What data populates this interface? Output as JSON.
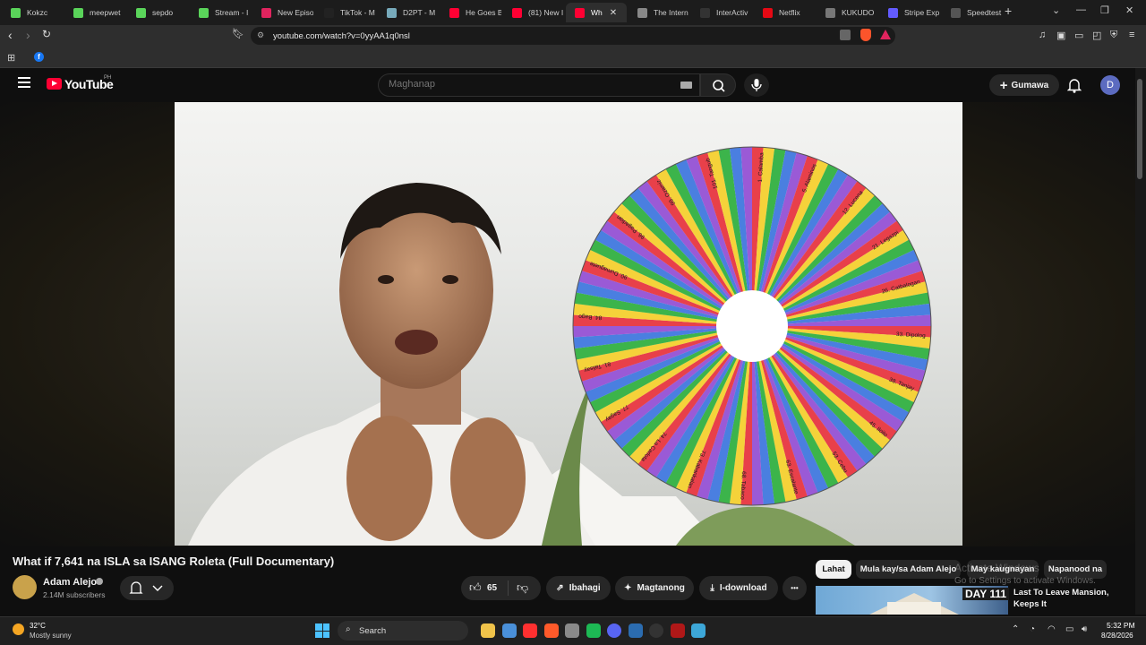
{
  "browser": {
    "tabs": [
      {
        "label": "Kokzc",
        "color": "#5ad45a"
      },
      {
        "label": "meepwet",
        "color": "#5ad45a"
      },
      {
        "label": "sepdo",
        "color": "#5ad45a"
      },
      {
        "label": "Stream - I",
        "color": "#5ad45a"
      },
      {
        "label": "New Episo",
        "color": "#e0245e"
      },
      {
        "label": "TikTok - M",
        "color": "#222222"
      },
      {
        "label": "D2PT - M",
        "color": "#7ab"
      },
      {
        "label": "He Goes B",
        "color": "#ff0033"
      },
      {
        "label": "(81) New I",
        "color": "#ff0033"
      },
      {
        "label": "Wh",
        "color": "#ff0033"
      },
      {
        "label": "The Intern",
        "color": "#888888"
      },
      {
        "label": "InterActiv",
        "color": "#333333"
      },
      {
        "label": "Netflix",
        "color": "#e50914"
      },
      {
        "label": "KUKUDO",
        "color": "#777777"
      },
      {
        "label": "Stripe Exp",
        "color": "#635bff"
      },
      {
        "label": "Speedtest",
        "color": "#555555"
      }
    ],
    "active_tab_index": 9,
    "new_tab": "+",
    "url": "youtube.com/watch?v=0yyAA1q0nsl"
  },
  "youtube": {
    "logo_text": "YouTube",
    "country": "PH",
    "search_placeholder": "Maghanap",
    "create_label": "Gumawa",
    "avatar_letter": "D",
    "avatar_color": "#5c6bc0"
  },
  "video": {
    "title": "What if 7,641 na ISLA sa ISANG Roleta (Full Documentary)",
    "channel": "Adam Alejo",
    "subscribers": "2.14M subscribers",
    "likes": "65",
    "share_label": "Ibahagi",
    "ask_label": "Magtanong",
    "download_label": "I-download",
    "more": "•••",
    "wheel_colors": [
      "#e8404a",
      "#f5d23a",
      "#3cb44b",
      "#4a7fe0",
      "#9a5ad6"
    ],
    "wheel_labels": [
      {
        "n": "1",
        "t": "Calamba"
      },
      {
        "n": "5",
        "t": "Alaminos"
      },
      {
        "n": "12",
        "t": "Lucena"
      },
      {
        "n": "21",
        "t": "Legazpi"
      },
      {
        "n": "26",
        "t": "Catbalogan"
      },
      {
        "n": "33",
        "t": "Dipolog"
      },
      {
        "n": "38",
        "t": "Tanjay"
      },
      {
        "n": "45",
        "t": "Iloilo"
      },
      {
        "n": "53",
        "t": "Cebu"
      },
      {
        "n": "63",
        "t": "Escalante"
      },
      {
        "n": "68",
        "t": "Tabaco"
      },
      {
        "n": "73",
        "t": "Kabankalan"
      },
      {
        "n": "74",
        "t": "La Carlota"
      },
      {
        "n": "77",
        "t": "Sagay"
      },
      {
        "n": "81",
        "t": "Talisay"
      },
      {
        "n": "84",
        "t": "Bago"
      },
      {
        "n": "90",
        "t": "Dumaguete"
      },
      {
        "n": "96",
        "t": "Pagadian"
      },
      {
        "n": "99",
        "t": "Ozamiz"
      },
      {
        "n": "101",
        "t": "Tangub"
      }
    ]
  },
  "sidebar": {
    "chips": [
      "Lahat",
      "Mula kay/sa Adam Alejo",
      "May kaugnayan",
      "Napanood na"
    ],
    "watermark_title": "Activate Windows",
    "watermark_sub": "Go to Settings to activate Windows.",
    "rec_badge": "DAY 111",
    "rec_title": "Last To Leave Mansion, Keeps It"
  },
  "taskbar": {
    "temp": "32°C",
    "weather": "Mostly sunny",
    "search_label": "Search",
    "time": "5:32 PM",
    "date": "8/28/2026",
    "apps": [
      "#f0c34a",
      "#4a90d9",
      "#ff3030",
      "#ff5a2a",
      "#8a8a8a",
      "#1db954",
      "#5865f2",
      "#2b6cb0",
      "#333333",
      "#b01818",
      "#3da7d8"
    ]
  }
}
